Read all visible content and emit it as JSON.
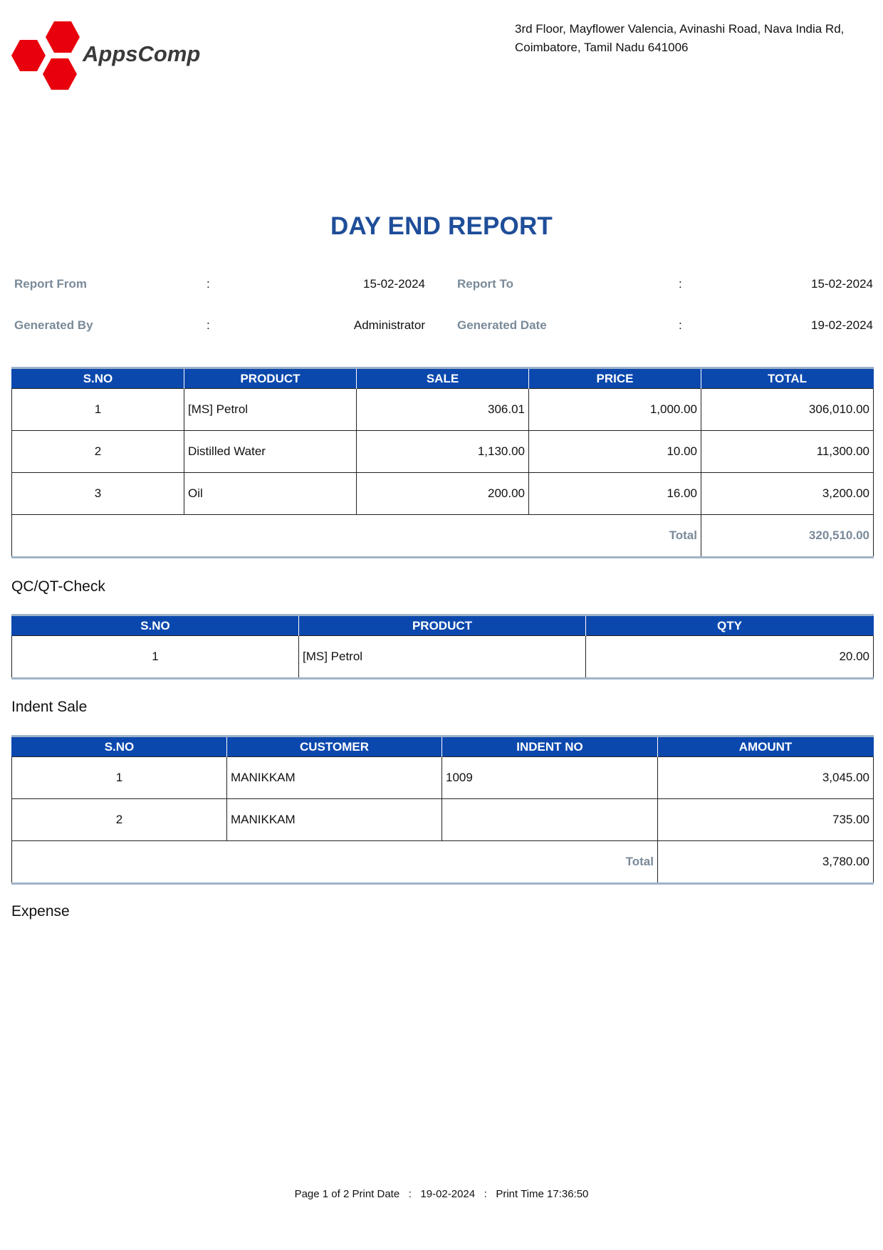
{
  "brand": {
    "name": "AppsComp",
    "color": "#e8000d"
  },
  "address": {
    "line1": "3rd Floor, Mayflower Valencia, Avinashi Road, Nava India Rd,",
    "line2": "Coimbatore, Tamil Nadu 641006"
  },
  "title": "DAY END REPORT",
  "meta": {
    "report_from_label": "Report From",
    "report_from": "15-02-2024",
    "report_to_label": "Report To",
    "report_to": "15-02-2024",
    "generated_by_label": "Generated By",
    "generated_by": "Administrator",
    "generated_date_label": "Generated Date",
    "generated_date": "19-02-2024",
    "colon": ":"
  },
  "sales_table": {
    "headers": [
      "S.NO",
      "PRODUCT",
      "SALE",
      "PRICE",
      "TOTAL"
    ],
    "rows": [
      [
        "1",
        "[MS] Petrol",
        "306.01",
        "1,000.00",
        "306,010.00"
      ],
      [
        "2",
        "Distilled Water",
        "1,130.00",
        "10.00",
        "11,300.00"
      ],
      [
        "3",
        "Oil",
        "200.00",
        "16.00",
        "3,200.00"
      ]
    ],
    "total_label": "Total",
    "total_value": "320,510.00"
  },
  "qc_section": {
    "title": "QC/QT-Check",
    "headers": [
      "S.NO",
      "PRODUCT",
      "QTY"
    ],
    "rows": [
      [
        "1",
        "[MS] Petrol",
        "20.00"
      ]
    ]
  },
  "indent_section": {
    "title": "Indent Sale",
    "headers": [
      "S.NO",
      "CUSTOMER",
      "INDENT NO",
      "AMOUNT"
    ],
    "rows": [
      [
        "1",
        "MANIKKAM",
        "1009",
        "3,045.00"
      ],
      [
        "2",
        "MANIKKAM",
        "",
        "735.00"
      ]
    ],
    "total_label": "Total",
    "total_value": "3,780.00"
  },
  "expense_section": {
    "title": "Expense"
  },
  "footer": {
    "page": "Page 1 of 2",
    "print_date_label": "Print Date",
    "print_date": "19-02-2024",
    "print_time_label": "Print Time",
    "print_time": "17:36:50",
    "colon": ":"
  },
  "colors": {
    "header_bg": "#0b48ad",
    "title": "#1f4e99",
    "muted_label": "#7a8a99",
    "rule": "#9fb3c8"
  }
}
